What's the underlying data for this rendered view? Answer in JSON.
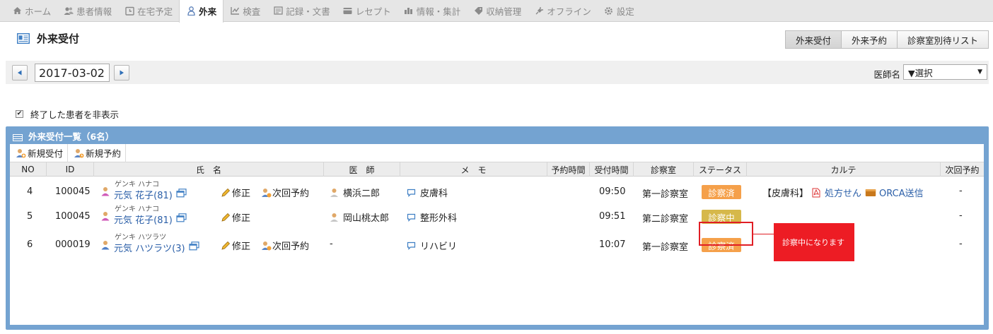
{
  "nav": {
    "tabs": [
      {
        "label": "ホーム",
        "icon": "home-icon"
      },
      {
        "label": "患者情報",
        "icon": "patients-icon"
      },
      {
        "label": "在宅予定",
        "icon": "clock-icon"
      },
      {
        "label": "外来",
        "icon": "person-icon",
        "active": true
      },
      {
        "label": "検査",
        "icon": "chart-icon"
      },
      {
        "label": "記録・文書",
        "icon": "document-icon"
      },
      {
        "label": "レセプト",
        "icon": "card-icon"
      },
      {
        "label": "情報・集計",
        "icon": "stats-icon"
      },
      {
        "label": "収納管理",
        "icon": "tag-icon"
      },
      {
        "label": "オフライン",
        "icon": "plug-icon"
      },
      {
        "label": "設定",
        "icon": "gear-icon"
      }
    ]
  },
  "header": {
    "title": "外来受付",
    "buttons": [
      "外来受付",
      "外来予約",
      "診察室別待リスト"
    ]
  },
  "datebar": {
    "date": "2017-03-02",
    "doctor_label": "医師名",
    "doctor_value": "▼選択"
  },
  "filter": {
    "hide_finished_label": "終了した患者を非表示",
    "hide_finished_checked": true
  },
  "panel": {
    "title": "外来受付一覧（6名）",
    "toolbar": {
      "new_reception": "新規受付",
      "new_appointment": "新規予約"
    },
    "columns": [
      "NO",
      "ID",
      "氏　名",
      "医　師",
      "メ　モ",
      "予約時間",
      "受付時間",
      "診察室",
      "ステータス",
      "カルテ",
      "次回予約"
    ],
    "edit_label": "修正",
    "next_label": "次回予約",
    "rows": [
      {
        "no": "4",
        "id": "100045",
        "kana": "ゲンキ ハナコ",
        "name": "元気 花子(81)",
        "gender": "female",
        "has_next": true,
        "doctor": "横浜二郎",
        "memo": "皮膚科",
        "reserve_time": "",
        "reception_time": "09:50",
        "room": "第一診察室",
        "status": "診察済",
        "status_color": "#f5a04a",
        "karte_dept": "【皮膚科】",
        "karte_prescription": "処方せん",
        "karte_orca": "ORCA送信",
        "next": "-"
      },
      {
        "no": "5",
        "id": "100045",
        "kana": "ゲンキ ハナコ",
        "name": "元気 花子(81)",
        "gender": "female",
        "has_next": false,
        "doctor": "岡山桃太郎",
        "memo": "整形外科",
        "reserve_time": "",
        "reception_time": "09:51",
        "room": "第二診察室",
        "status": "診察中",
        "status_color": "#d6b84a",
        "karte_dept": "",
        "karte_prescription": "",
        "karte_orca": "",
        "next": "-"
      },
      {
        "no": "6",
        "id": "000019",
        "kana": "ゲンキ ハツラツ",
        "name": "元気 ハツラツ(3)",
        "gender": "male",
        "has_next": true,
        "doctor": "-",
        "memo": "リハビリ",
        "reserve_time": "",
        "reception_time": "10:07",
        "room": "第一診察室",
        "status": "診察済",
        "status_color": "#f5a04a",
        "karte_dept": "",
        "karte_prescription": "",
        "karte_orca": "",
        "next": "-"
      }
    ]
  },
  "callout": {
    "text": "診察中になります"
  }
}
